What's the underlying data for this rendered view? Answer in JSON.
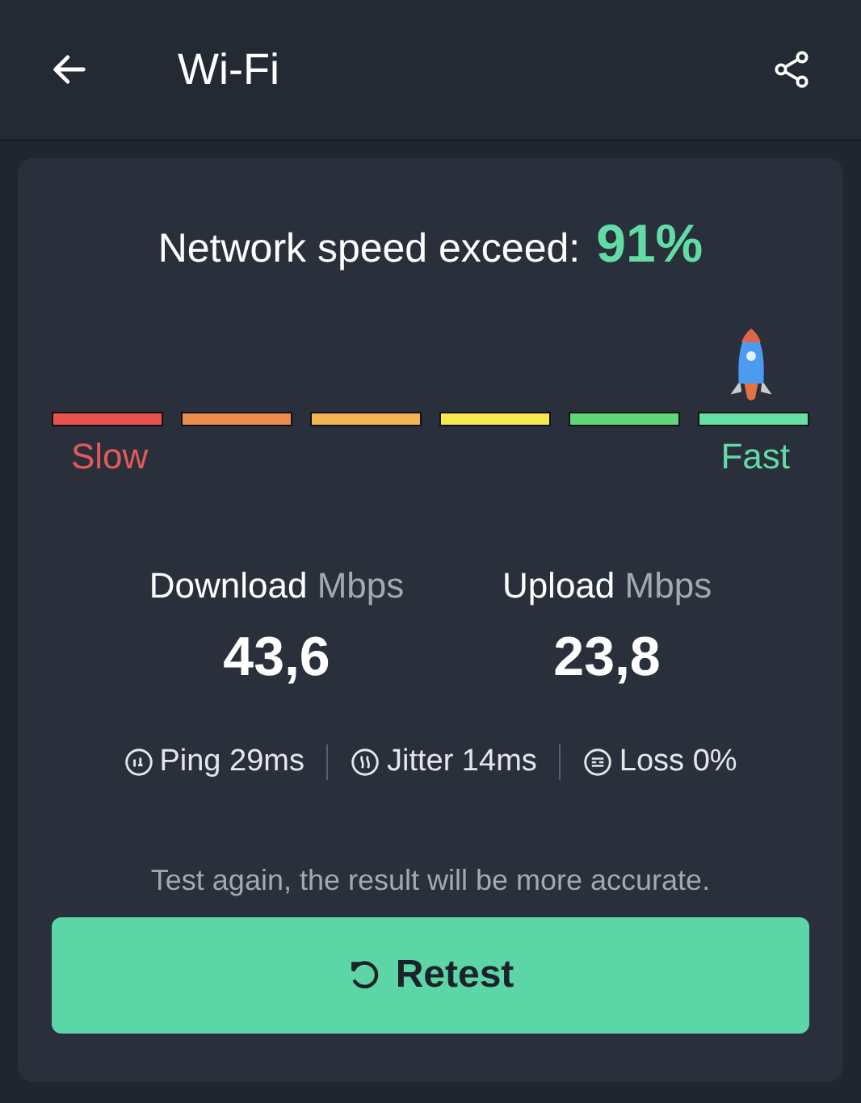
{
  "app_bar": {
    "title": "Wi-Fi"
  },
  "result": {
    "label": "Network speed exceed:",
    "value": "91%",
    "segments": [
      {
        "color": "#e8524f"
      },
      {
        "color": "#eb8c4f"
      },
      {
        "color": "#f2b552"
      },
      {
        "color": "#f5e94f"
      },
      {
        "color": "#5fd67a"
      },
      {
        "color": "#62e0a6"
      }
    ],
    "slow_label": "Slow",
    "fast_label": "Fast"
  },
  "speeds": [
    {
      "label": "Download",
      "unit": "Mbps",
      "value": "43,6"
    },
    {
      "label": "Upload",
      "unit": "Mbps",
      "value": "23,8"
    }
  ],
  "metrics": [
    {
      "kind": "ping",
      "text": "Ping 29ms"
    },
    {
      "kind": "jitter",
      "text": "Jitter 14ms"
    },
    {
      "kind": "loss",
      "text": "Loss 0%"
    }
  ],
  "hint": "Test again, the result will be more accurate.",
  "retest_button": "Retest"
}
